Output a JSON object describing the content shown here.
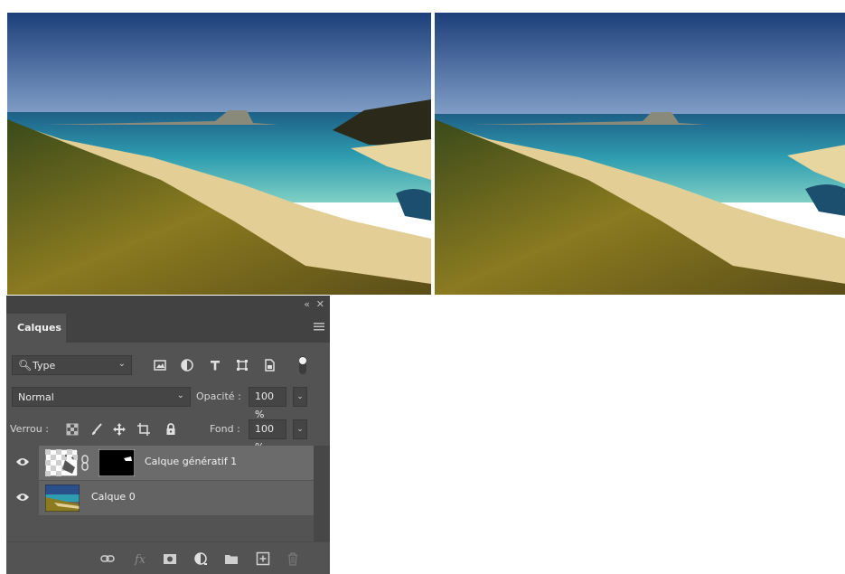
{
  "panel": {
    "tab_label": "Calques",
    "filter": {
      "label": "Type",
      "icons": [
        "image-filter-icon",
        "adjustment-filter-icon",
        "type-filter-icon",
        "shape-filter-icon",
        "smart-object-filter-icon",
        "filter-toggle-icon"
      ]
    },
    "blend_mode": "Normal",
    "opacity_label": "Opacité :",
    "opacity_value": "100 %",
    "lock_label": "Verrou :",
    "fill_label": "Fond :",
    "fill_value": "100 %",
    "layers": [
      {
        "name": "Calque génératif 1",
        "visible": true,
        "selected": true,
        "has_mask": true
      },
      {
        "name": "Calque 0",
        "visible": true,
        "selected": false,
        "has_mask": false
      }
    ],
    "bottom_icons": [
      "link-layers-icon",
      "fx-icon",
      "add-mask-icon",
      "adjustment-layer-icon",
      "group-folder-icon",
      "new-layer-icon",
      "delete-icon"
    ]
  }
}
